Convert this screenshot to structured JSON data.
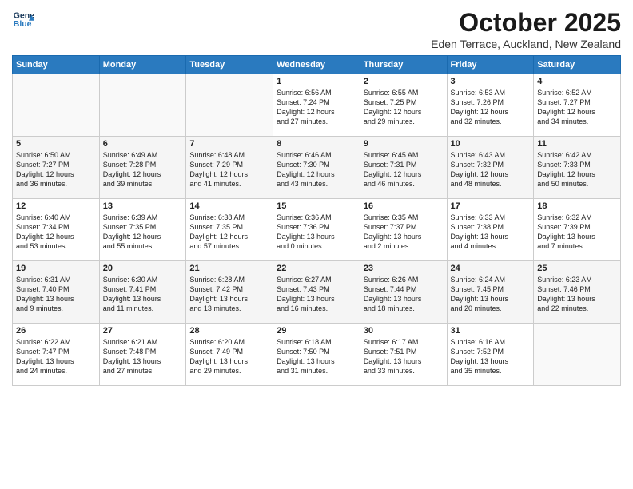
{
  "header": {
    "logo_line1": "General",
    "logo_line2": "Blue",
    "month": "October 2025",
    "location": "Eden Terrace, Auckland, New Zealand"
  },
  "days_of_week": [
    "Sunday",
    "Monday",
    "Tuesday",
    "Wednesday",
    "Thursday",
    "Friday",
    "Saturday"
  ],
  "weeks": [
    [
      {
        "day": "",
        "text": ""
      },
      {
        "day": "",
        "text": ""
      },
      {
        "day": "",
        "text": ""
      },
      {
        "day": "1",
        "text": "Sunrise: 6:56 AM\nSunset: 7:24 PM\nDaylight: 12 hours\nand 27 minutes."
      },
      {
        "day": "2",
        "text": "Sunrise: 6:55 AM\nSunset: 7:25 PM\nDaylight: 12 hours\nand 29 minutes."
      },
      {
        "day": "3",
        "text": "Sunrise: 6:53 AM\nSunset: 7:26 PM\nDaylight: 12 hours\nand 32 minutes."
      },
      {
        "day": "4",
        "text": "Sunrise: 6:52 AM\nSunset: 7:27 PM\nDaylight: 12 hours\nand 34 minutes."
      }
    ],
    [
      {
        "day": "5",
        "text": "Sunrise: 6:50 AM\nSunset: 7:27 PM\nDaylight: 12 hours\nand 36 minutes."
      },
      {
        "day": "6",
        "text": "Sunrise: 6:49 AM\nSunset: 7:28 PM\nDaylight: 12 hours\nand 39 minutes."
      },
      {
        "day": "7",
        "text": "Sunrise: 6:48 AM\nSunset: 7:29 PM\nDaylight: 12 hours\nand 41 minutes."
      },
      {
        "day": "8",
        "text": "Sunrise: 6:46 AM\nSunset: 7:30 PM\nDaylight: 12 hours\nand 43 minutes."
      },
      {
        "day": "9",
        "text": "Sunrise: 6:45 AM\nSunset: 7:31 PM\nDaylight: 12 hours\nand 46 minutes."
      },
      {
        "day": "10",
        "text": "Sunrise: 6:43 AM\nSunset: 7:32 PM\nDaylight: 12 hours\nand 48 minutes."
      },
      {
        "day": "11",
        "text": "Sunrise: 6:42 AM\nSunset: 7:33 PM\nDaylight: 12 hours\nand 50 minutes."
      }
    ],
    [
      {
        "day": "12",
        "text": "Sunrise: 6:40 AM\nSunset: 7:34 PM\nDaylight: 12 hours\nand 53 minutes."
      },
      {
        "day": "13",
        "text": "Sunrise: 6:39 AM\nSunset: 7:35 PM\nDaylight: 12 hours\nand 55 minutes."
      },
      {
        "day": "14",
        "text": "Sunrise: 6:38 AM\nSunset: 7:35 PM\nDaylight: 12 hours\nand 57 minutes."
      },
      {
        "day": "15",
        "text": "Sunrise: 6:36 AM\nSunset: 7:36 PM\nDaylight: 13 hours\nand 0 minutes."
      },
      {
        "day": "16",
        "text": "Sunrise: 6:35 AM\nSunset: 7:37 PM\nDaylight: 13 hours\nand 2 minutes."
      },
      {
        "day": "17",
        "text": "Sunrise: 6:33 AM\nSunset: 7:38 PM\nDaylight: 13 hours\nand 4 minutes."
      },
      {
        "day": "18",
        "text": "Sunrise: 6:32 AM\nSunset: 7:39 PM\nDaylight: 13 hours\nand 7 minutes."
      }
    ],
    [
      {
        "day": "19",
        "text": "Sunrise: 6:31 AM\nSunset: 7:40 PM\nDaylight: 13 hours\nand 9 minutes."
      },
      {
        "day": "20",
        "text": "Sunrise: 6:30 AM\nSunset: 7:41 PM\nDaylight: 13 hours\nand 11 minutes."
      },
      {
        "day": "21",
        "text": "Sunrise: 6:28 AM\nSunset: 7:42 PM\nDaylight: 13 hours\nand 13 minutes."
      },
      {
        "day": "22",
        "text": "Sunrise: 6:27 AM\nSunset: 7:43 PM\nDaylight: 13 hours\nand 16 minutes."
      },
      {
        "day": "23",
        "text": "Sunrise: 6:26 AM\nSunset: 7:44 PM\nDaylight: 13 hours\nand 18 minutes."
      },
      {
        "day": "24",
        "text": "Sunrise: 6:24 AM\nSunset: 7:45 PM\nDaylight: 13 hours\nand 20 minutes."
      },
      {
        "day": "25",
        "text": "Sunrise: 6:23 AM\nSunset: 7:46 PM\nDaylight: 13 hours\nand 22 minutes."
      }
    ],
    [
      {
        "day": "26",
        "text": "Sunrise: 6:22 AM\nSunset: 7:47 PM\nDaylight: 13 hours\nand 24 minutes."
      },
      {
        "day": "27",
        "text": "Sunrise: 6:21 AM\nSunset: 7:48 PM\nDaylight: 13 hours\nand 27 minutes."
      },
      {
        "day": "28",
        "text": "Sunrise: 6:20 AM\nSunset: 7:49 PM\nDaylight: 13 hours\nand 29 minutes."
      },
      {
        "day": "29",
        "text": "Sunrise: 6:18 AM\nSunset: 7:50 PM\nDaylight: 13 hours\nand 31 minutes."
      },
      {
        "day": "30",
        "text": "Sunrise: 6:17 AM\nSunset: 7:51 PM\nDaylight: 13 hours\nand 33 minutes."
      },
      {
        "day": "31",
        "text": "Sunrise: 6:16 AM\nSunset: 7:52 PM\nDaylight: 13 hours\nand 35 minutes."
      },
      {
        "day": "",
        "text": ""
      }
    ]
  ]
}
